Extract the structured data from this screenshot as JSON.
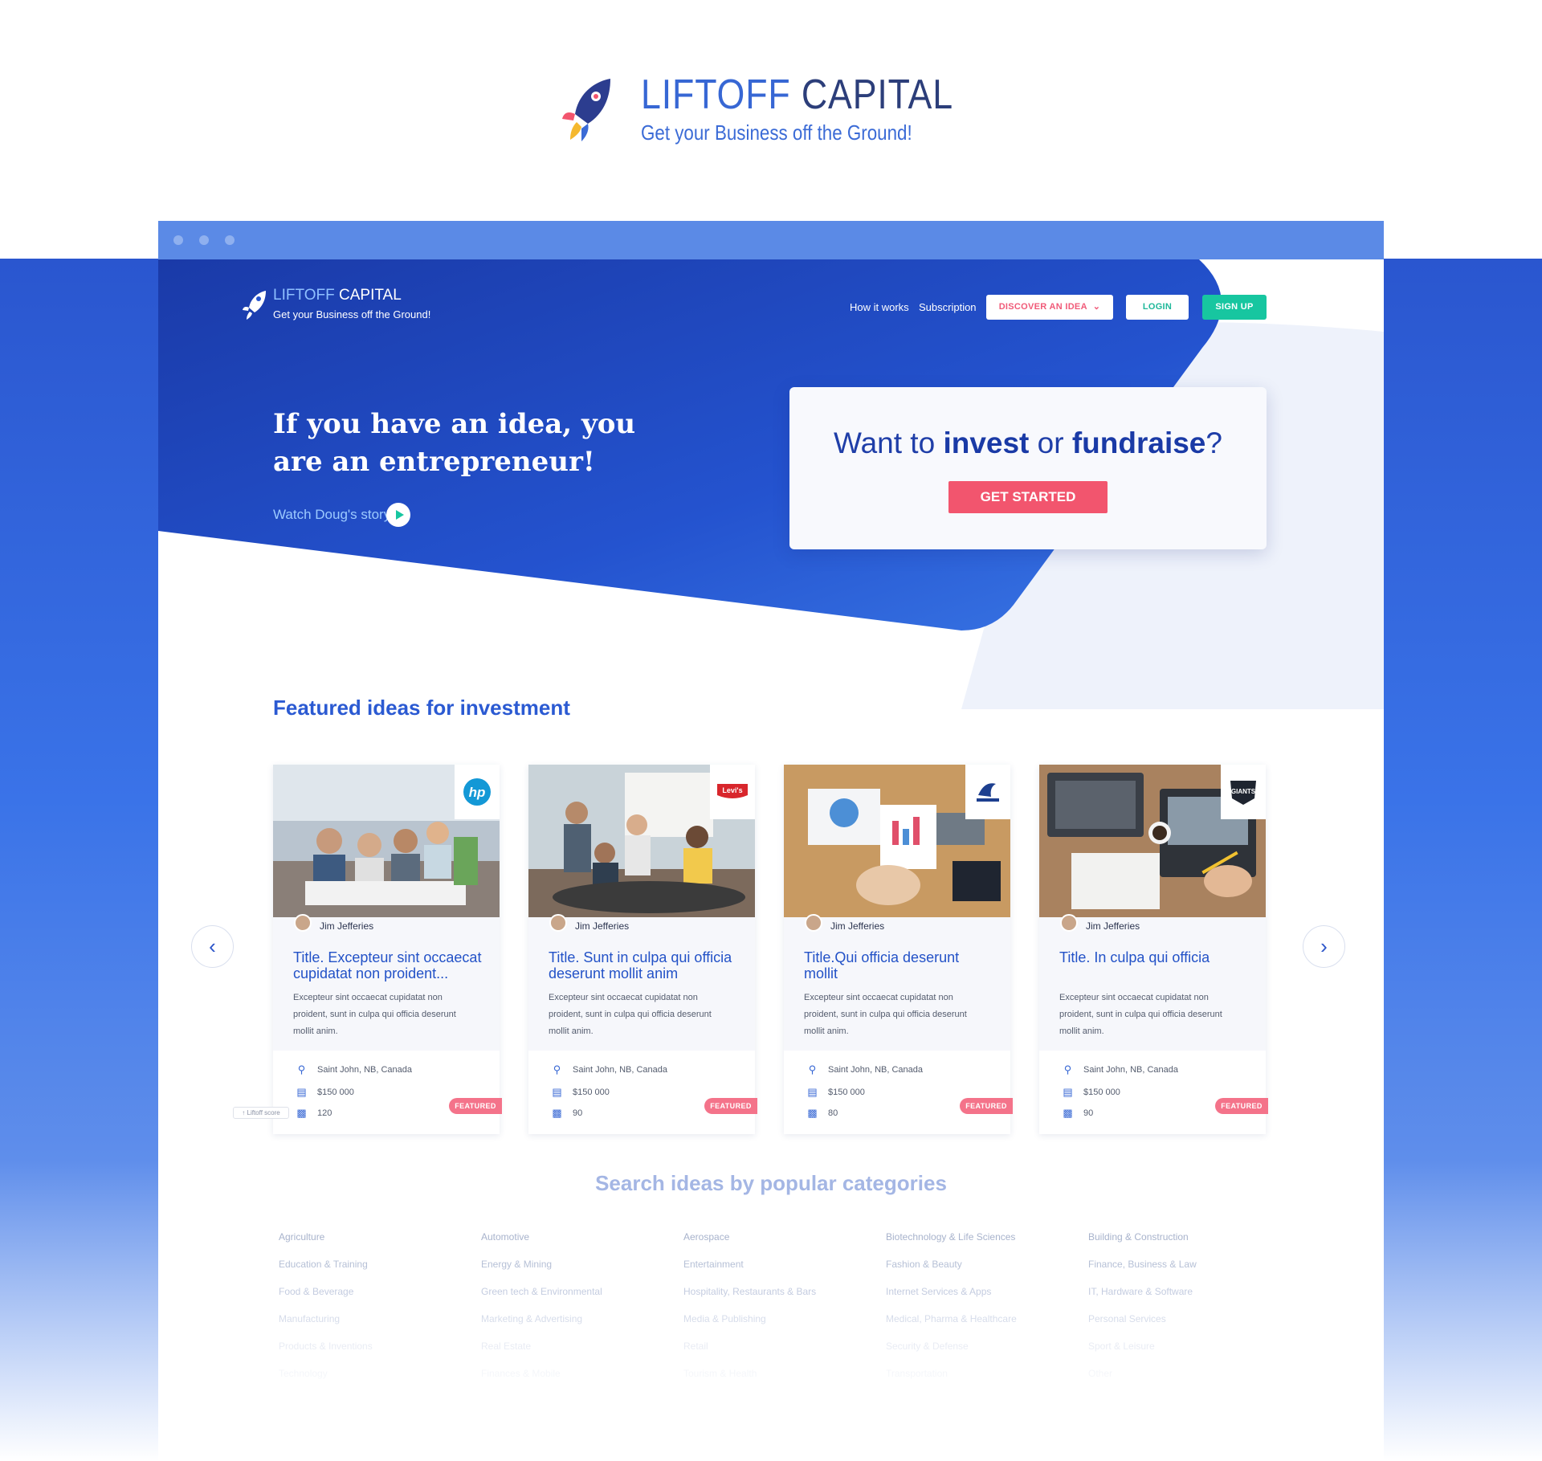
{
  "brand": {
    "name_part1": "LIFTOFF",
    "name_part2": "CAPITAL",
    "tagline": "Get your Business off the Ground!"
  },
  "nav": {
    "brand_part1": "LIFTOFF",
    "brand_part2": "CAPITAL",
    "tagline": "Get your Business off the Ground!",
    "links": [
      "How it works",
      "Subscription"
    ],
    "discover_label": "DISCOVER AN IDEA",
    "login_label": "LOGIN",
    "signup_label": "SIGN UP"
  },
  "hero": {
    "title": "If you have an idea, you are an entrepreneur!",
    "watch_label": "Watch Doug's story"
  },
  "cta": {
    "pre": "Want to ",
    "invest": "invest",
    "mid": " or ",
    "fundraise": "fundraise",
    "post": "?",
    "button": "GET STARTED"
  },
  "featured": {
    "heading": "Featured ideas for investment",
    "cards": [
      {
        "brand": "hp",
        "author": "Jim Jefferies",
        "title": "Title. Excepteur sint occaecat cupidatat non proident...",
        "desc": "Excepteur sint occaecat cupidatat non proident, sunt in culpa qui officia deserunt mollit anim.",
        "location": "Saint John, NB, Canada",
        "amount": "$150 000",
        "score": "120",
        "badge": "FEATURED"
      },
      {
        "brand": "Levi's",
        "author": "Jim Jefferies",
        "title": "Title. Sunt in culpa qui officia deserunt mollit anim",
        "desc": "Excepteur sint occaecat cupidatat non proident, sunt in culpa qui officia deserunt mollit anim.",
        "location": "Saint John, NB, Canada",
        "amount": "$150 000",
        "score": "90",
        "badge": "FEATURED"
      },
      {
        "brand": "DreamWorks",
        "author": "Jim Jefferies",
        "title": "Title.Qui officia deserunt mollit",
        "desc": "Excepteur sint occaecat cupidatat non proident, sunt in culpa qui officia deserunt mollit anim.",
        "location": "Saint John, NB, Canada",
        "amount": "$150 000",
        "score": "80",
        "badge": "FEATURED"
      },
      {
        "brand": "GIANTS",
        "author": "Jim Jefferies",
        "title": "Title. In culpa qui officia",
        "desc": "Excepteur sint occaecat cupidatat non proident, sunt in culpa qui officia deserunt mollit anim.",
        "location": "Saint John, NB, Canada",
        "amount": "$150 000",
        "score": "90",
        "badge": "FEATURED"
      }
    ],
    "liftoff_score_label": "Liftoff score"
  },
  "categories": {
    "heading": "Search ideas by popular categories",
    "items": [
      "Agriculture",
      "Automotive",
      "Aerospace",
      "Biotechnology & Life Sciences",
      "Building & Construction",
      "Education & Training",
      "Energy & Mining",
      "Entertainment",
      "Fashion & Beauty",
      "Finance, Business & Law",
      "Food & Beverage",
      "Green tech & Environmental",
      "Hospitality, Restaurants & Bars",
      "Internet Services & Apps",
      "IT, Hardware & Software",
      "Manufacturing",
      "Marketing & Advertising",
      "Media & Publishing",
      "Medical, Pharma & Healthcare",
      "Personal Services",
      "Products & Inventions",
      "Real Estate",
      "Retail",
      "Security & Defense",
      "Sport & Leisure",
      "Technology",
      "Finances & Mobile",
      "Tourism & Health",
      "Transportation",
      "Other"
    ]
  },
  "colors": {
    "primary": "#2352c7",
    "hero_blue": "#1e40b8",
    "cta_red": "#f2556e",
    "signup_green": "#17c6a0",
    "featured_pink": "#f4738a"
  }
}
